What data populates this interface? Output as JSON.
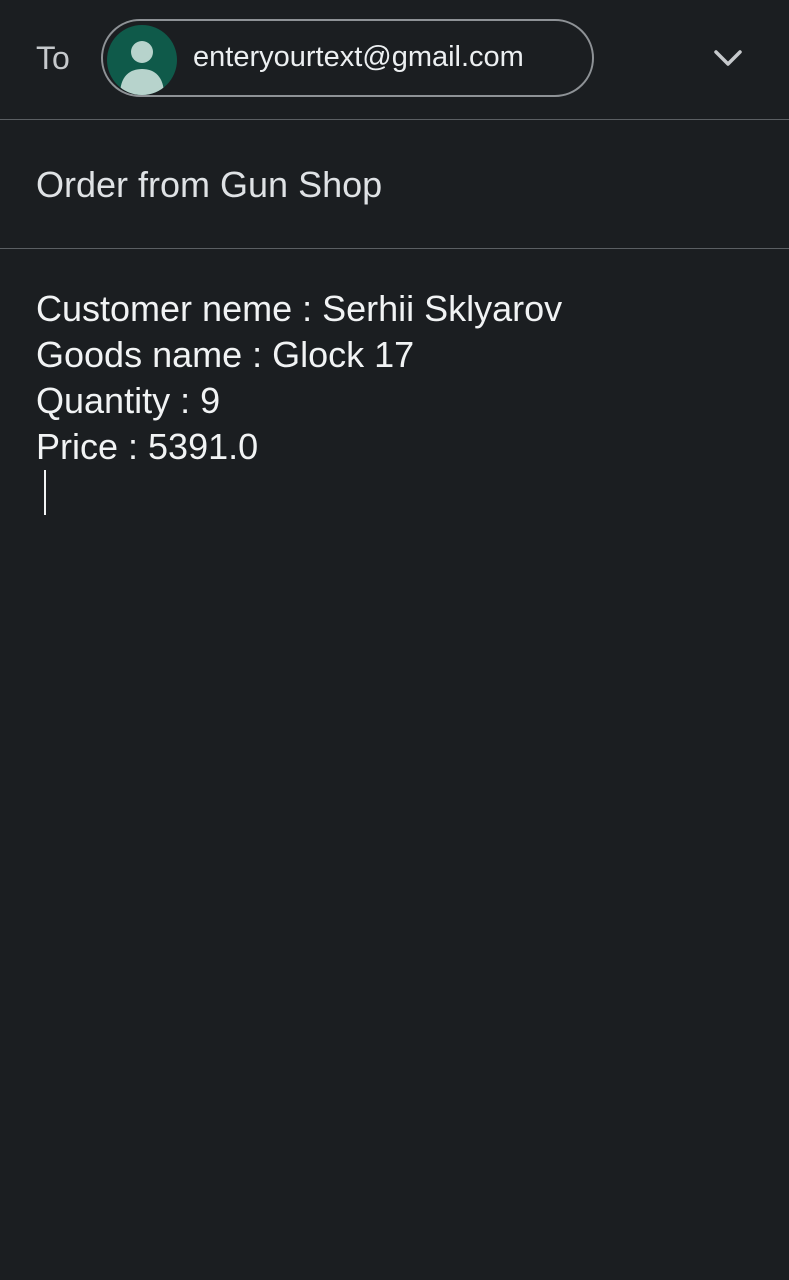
{
  "compose": {
    "to_label": "To",
    "recipient_chip": {
      "email": "enteryourtext@gmail.com",
      "avatar_icon": "person-icon"
    },
    "expand_icon": "chevron-down-icon",
    "subject": "Order from Gun Shop",
    "body_lines": [
      "Customer neme : Serhii Sklyarov",
      "Goods name : Glock 17",
      "Quantity : 9",
      "Price : 5391.0"
    ]
  },
  "colors": {
    "background": "#1b1e21",
    "divider": "#5b5f63",
    "avatar_bg": "#0f5a4a",
    "avatar_fg": "#b7d3cc"
  }
}
